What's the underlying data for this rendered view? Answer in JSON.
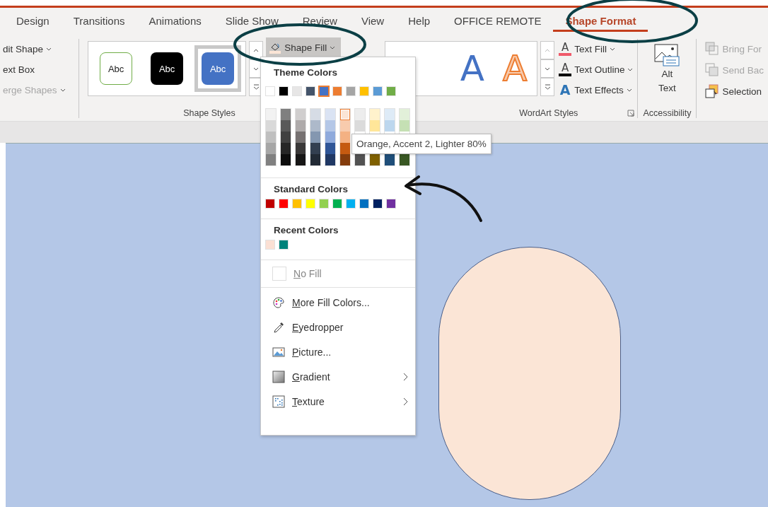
{
  "tabs": [
    {
      "label": "Design",
      "selected": false
    },
    {
      "label": "Transitions",
      "selected": false
    },
    {
      "label": "Animations",
      "selected": false
    },
    {
      "label": "Slide Show",
      "selected": false
    },
    {
      "label": "Review",
      "selected": false
    },
    {
      "label": "View",
      "selected": false
    },
    {
      "label": "Help",
      "selected": false
    },
    {
      "label": "OFFICE REMOTE",
      "selected": false
    },
    {
      "label": "Shape Format",
      "selected": true
    }
  ],
  "insert_shapes": {
    "items": [
      {
        "label": "dit Shape",
        "disabled": false
      },
      {
        "label": "ext Box",
        "disabled": false
      },
      {
        "label": "erge Shapes",
        "disabled": true
      }
    ]
  },
  "shape_styles": {
    "label": "Shape Styles",
    "styles": [
      {
        "label": "Abc",
        "kind": "outline",
        "selected": false
      },
      {
        "label": "Abc",
        "kind": "dark",
        "selected": false
      },
      {
        "label": "Abc",
        "kind": "accent",
        "selected": true
      }
    ],
    "shape_fill": {
      "label": "Shape Fill",
      "pressed": true
    }
  },
  "wordart_styles": {
    "label": "WordArt Styles",
    "styles": [
      {
        "label": "A",
        "kind": "fill"
      },
      {
        "label": "A",
        "kind": "outline"
      }
    ],
    "commands": [
      {
        "icon": "A",
        "label": "Text Fill",
        "kind": "fill"
      },
      {
        "icon": "A",
        "label": "Text Outline",
        "kind": "outline"
      },
      {
        "icon": "A",
        "label": "Text Effects",
        "kind": "effects"
      }
    ]
  },
  "accessibility": {
    "label": "Accessibility",
    "button": "Alt\nText"
  },
  "arrange": {
    "items": [
      {
        "label": "Bring For",
        "disabled": true,
        "kind": "bring"
      },
      {
        "label": "Send Bac",
        "disabled": true,
        "kind": "send"
      },
      {
        "label": "Selection",
        "disabled": false,
        "kind": "selection"
      }
    ]
  },
  "fill_menu": {
    "theme_title": "Theme Colors",
    "theme_colors": [
      {
        "color": "#ffffff",
        "selected": false,
        "shades": [
          {
            "color": "#f2f2f2",
            "hovered": false
          },
          {
            "color": "#d9d9d9",
            "hovered": false
          },
          {
            "color": "#bfbfbf",
            "hovered": false
          },
          {
            "color": "#a6a6a6",
            "hovered": false
          },
          {
            "color": "#808080",
            "hovered": false
          }
        ]
      },
      {
        "color": "#000000",
        "selected": false,
        "shades": [
          {
            "color": "#7f7f7f",
            "hovered": false
          },
          {
            "color": "#595959",
            "hovered": false
          },
          {
            "color": "#404040",
            "hovered": false
          },
          {
            "color": "#262626",
            "hovered": false
          },
          {
            "color": "#0d0d0d",
            "hovered": false
          }
        ]
      },
      {
        "color": "#e7e6e6",
        "selected": false,
        "shades": [
          {
            "color": "#d0cece",
            "hovered": false
          },
          {
            "color": "#aeaaaa",
            "hovered": false
          },
          {
            "color": "#767171",
            "hovered": false
          },
          {
            "color": "#3a3838",
            "hovered": false
          },
          {
            "color": "#171616",
            "hovered": false
          }
        ]
      },
      {
        "color": "#44546a",
        "selected": false,
        "shades": [
          {
            "color": "#d6dce5",
            "hovered": false
          },
          {
            "color": "#adb9ca",
            "hovered": false
          },
          {
            "color": "#8497b0",
            "hovered": false
          },
          {
            "color": "#333f50",
            "hovered": false
          },
          {
            "color": "#222a35",
            "hovered": false
          }
        ]
      },
      {
        "color": "#4472c4",
        "selected": true,
        "shades": [
          {
            "color": "#dae3f3",
            "hovered": false
          },
          {
            "color": "#b4c7e7",
            "hovered": false
          },
          {
            "color": "#8faadc",
            "hovered": false
          },
          {
            "color": "#2f5597",
            "hovered": false
          },
          {
            "color": "#203864",
            "hovered": false
          }
        ]
      },
      {
        "color": "#ed7d31",
        "selected": false,
        "shades": [
          {
            "color": "#fbe5d6",
            "hovered": true
          },
          {
            "color": "#f8cbad",
            "hovered": false
          },
          {
            "color": "#f4b183",
            "hovered": false
          },
          {
            "color": "#c55a11",
            "hovered": false
          },
          {
            "color": "#843c0c",
            "hovered": false
          }
        ]
      },
      {
        "color": "#a5a5a5",
        "selected": false,
        "shades": [
          {
            "color": "#ededed",
            "hovered": false
          },
          {
            "color": "#dbdbdb",
            "hovered": false
          },
          {
            "color": "#525252",
            "hovered": false
          }
        ]
      },
      {
        "color": "#ffc000",
        "selected": false,
        "shades": [
          {
            "color": "#fff2cc",
            "hovered": false
          },
          {
            "color": "#ffe699",
            "hovered": false
          },
          {
            "color": "#7f6000",
            "hovered": false
          }
        ]
      },
      {
        "color": "#5b9bd5",
        "selected": false,
        "shades": [
          {
            "color": "#deebf7",
            "hovered": false
          },
          {
            "color": "#bdd7ee",
            "hovered": false
          },
          {
            "color": "#1f4e79",
            "hovered": false
          }
        ]
      },
      {
        "color": "#70ad47",
        "selected": false,
        "shades": [
          {
            "color": "#e2f0d9",
            "hovered": false
          },
          {
            "color": "#c5e0b4",
            "hovered": false
          },
          {
            "color": "#385723",
            "hovered": false
          }
        ]
      }
    ],
    "tooltip": "Orange, Accent 2, Lighter 80%",
    "standard_title": "Standard Colors",
    "standard_colors": [
      {
        "color": "#c00000"
      },
      {
        "color": "#ff0000"
      },
      {
        "color": "#ffc000"
      },
      {
        "color": "#ffff00"
      },
      {
        "color": "#92d050"
      },
      {
        "color": "#00b050"
      },
      {
        "color": "#00b0f0"
      },
      {
        "color": "#0070c0"
      },
      {
        "color": "#002060"
      },
      {
        "color": "#7030a0"
      }
    ],
    "recent_title": "Recent Colors",
    "recent_colors": [
      {
        "color": "#fbe0d4"
      },
      {
        "color": "#00827a"
      }
    ],
    "no_fill": {
      "label": "No Fill",
      "disabled": true
    },
    "commands": [
      {
        "label": "More Fill Colors...",
        "kind": "palette",
        "submenu": false
      },
      {
        "label": "Eyedropper",
        "kind": "eyedropper",
        "submenu": false
      },
      {
        "label": "Picture...",
        "kind": "picture",
        "submenu": false
      },
      {
        "label": "Gradient",
        "kind": "gradient",
        "submenu": true
      },
      {
        "label": "Texture",
        "kind": "texture",
        "submenu": true
      }
    ]
  }
}
